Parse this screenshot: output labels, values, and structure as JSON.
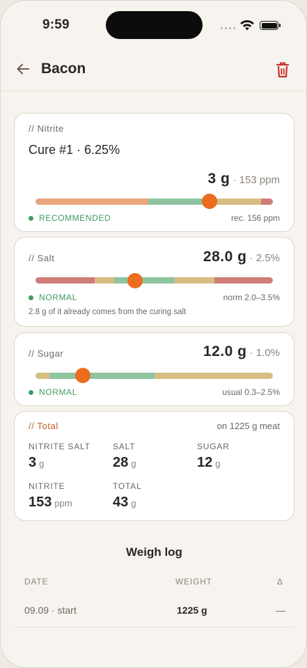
{
  "status_bar": {
    "time": "9:59"
  },
  "header": {
    "title": "Bacon"
  },
  "nitrite": {
    "tag": "// Nitrite",
    "cure": "Cure #1 · 6.25%",
    "amount": "3 g",
    "ratio": "· 153 ppm",
    "status": "RECOMMENDED",
    "rec": "rec. 156 ppm",
    "slider_position": 0.73,
    "colors": {
      "low": "#e9a57c",
      "ok": "#8fc4a0",
      "warn": "#d7bd82",
      "high": "#cf7d78",
      "thumb": "#ec6d1f"
    }
  },
  "salt": {
    "tag": "// Salt",
    "amount": "28.0 g",
    "ratio": "· 2.5%",
    "status": "NORMAL",
    "rec": "norm 2.0–3.5%",
    "note": "2.8 g of it already comes from the curing salt",
    "slider_position": 0.42
  },
  "sugar": {
    "tag": "// Sugar",
    "amount": "12.0 g",
    "ratio": "· 1.0%",
    "status": "NORMAL",
    "rec": "usual 0.3–2.5%",
    "slider_position": 0.2
  },
  "total": {
    "tag": "// Total",
    "meat": "on 1225 g meat",
    "items": [
      {
        "label": "NITRITE SALT",
        "value": "3",
        "unit": "g"
      },
      {
        "label": "SALT",
        "value": "28",
        "unit": "g"
      },
      {
        "label": "SUGAR",
        "value": "12",
        "unit": "g"
      },
      {
        "label": "NITRITE",
        "value": "153",
        "unit": "ppm"
      },
      {
        "label": "TOTAL",
        "value": "43",
        "unit": "g"
      }
    ]
  },
  "weigh_log": {
    "title": "Weigh log",
    "columns": [
      "DATE",
      "WEIGHT",
      "Δ"
    ],
    "rows": [
      {
        "date": "09.09 · start",
        "weight": "1225 g",
        "delta": "—"
      }
    ]
  }
}
